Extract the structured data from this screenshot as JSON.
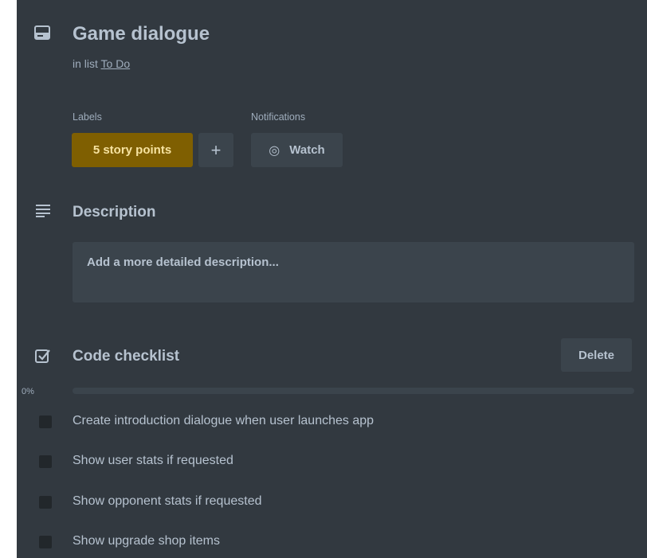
{
  "card": {
    "title": "Game dialogue",
    "in_list_prefix": "in list ",
    "list_name": "To Do"
  },
  "labels": {
    "heading": "Labels",
    "items": [
      {
        "text": "5 story points",
        "color": "#7f5f01"
      }
    ],
    "add_button": "+"
  },
  "notifications": {
    "heading": "Notifications",
    "watch_label": "Watch",
    "watch_icon": "eye-icon"
  },
  "description": {
    "heading": "Description",
    "placeholder": "Add a more detailed description..."
  },
  "checklist": {
    "title": "Code checklist",
    "delete_label": "Delete",
    "progress_percent": 0,
    "progress_text": "0%",
    "items": [
      {
        "text": "Create introduction dialogue when user launches app",
        "checked": false
      },
      {
        "text": "Show user stats if requested",
        "checked": false
      },
      {
        "text": "Show opponent stats if requested",
        "checked": false
      },
      {
        "text": "Show upgrade shop items",
        "checked": false
      }
    ]
  },
  "colors": {
    "panel_bg": "#323940",
    "text": "#b6c2cf",
    "subtle_text": "#9fadbc",
    "button_bg": "#3b444c",
    "label_yellow": "#7f5f01"
  }
}
